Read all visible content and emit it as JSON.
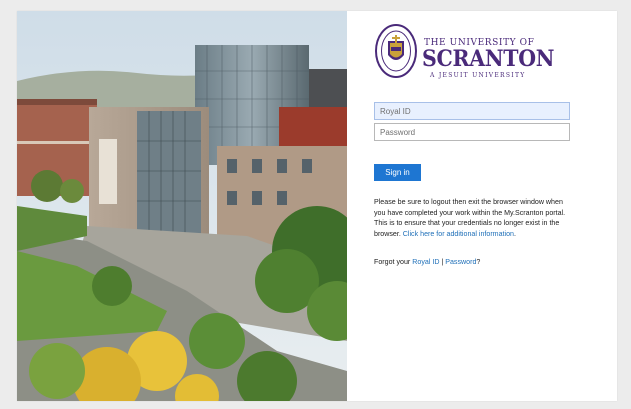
{
  "logo": {
    "top_line": "THE UNIVERSITY OF",
    "main": "SCRANTON",
    "sub": "A JESUIT UNIVERSITY",
    "seal_text": "UNIVERSITY OF SCRANTON",
    "color": "#4a2a7a"
  },
  "form": {
    "royal_id_placeholder": "Royal ID",
    "password_placeholder": "Password",
    "sign_in_label": "Sign in",
    "button_color": "#1e76d2"
  },
  "notice": {
    "text": "Please be sure to logout then exit the browser window when you have completed your work within the My.Scranton portal. This is to ensure that your credentials no longer exist in the browser. ",
    "link": "Click here for additional information",
    "end": "."
  },
  "forgot": {
    "prefix": "Forgot your ",
    "royal_id_link": "Royal ID",
    "separator": " | ",
    "password_link": "Password",
    "suffix": "?"
  },
  "link_color": "#1e6fb8"
}
